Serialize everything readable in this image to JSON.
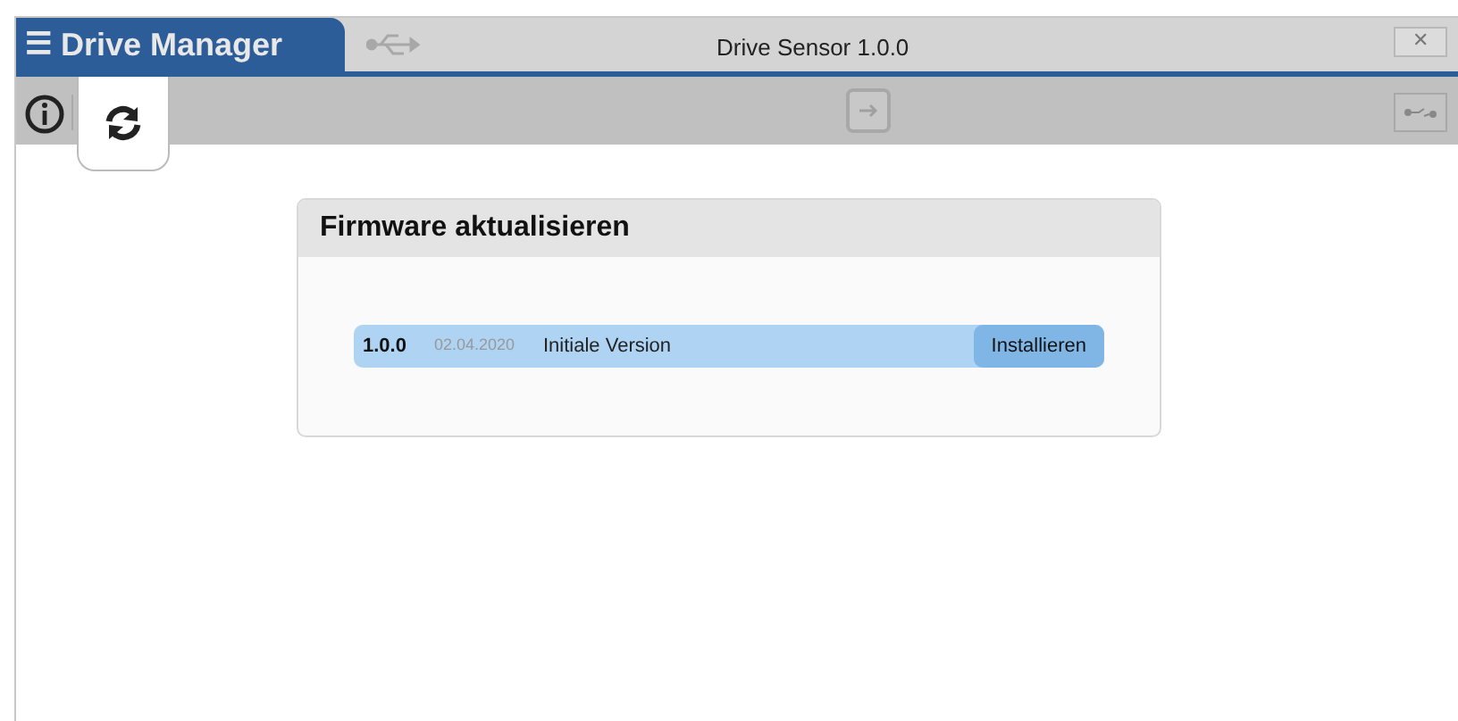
{
  "app": {
    "menu_glyph": "☰",
    "title": "Drive Manager"
  },
  "window": {
    "title": "Drive Sensor 1.0.0",
    "close": "✕"
  },
  "refresh_tab": {
    "selected": true
  },
  "card": {
    "title": "Firmware aktualisieren",
    "versions": [
      {
        "version": "1.0.0",
        "date": "02.04.2020",
        "description": "Initiale Version",
        "button": "Installieren",
        "selected": true
      }
    ]
  }
}
